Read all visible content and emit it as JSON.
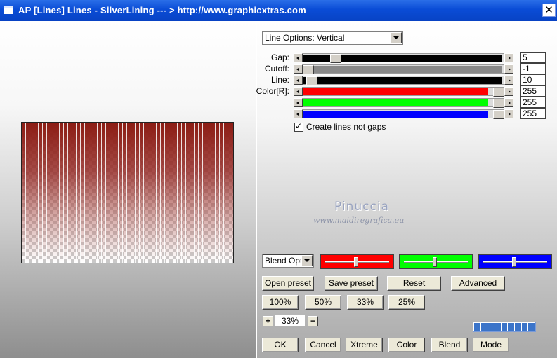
{
  "window": {
    "title": "AP [Lines]  Lines - SilverLining     --- > http://www.graphicxtras.com",
    "close_glyph": "✕"
  },
  "line_options": {
    "selected": "Line Options: Vertical"
  },
  "sliders": [
    {
      "label": "Gap:",
      "value": "5",
      "fill_color": "#000000",
      "level": 0.05
    },
    {
      "label": "Cutoff:",
      "value": "-1",
      "fill_color": "#888888",
      "level": 0.0
    },
    {
      "label": "Line:",
      "value": "10",
      "fill_color": "#000000",
      "level": 0.02
    },
    {
      "label": "Color[R]:",
      "value": "255",
      "fill_color": "#ff0000",
      "level": 1.0
    },
    {
      "label": "",
      "value": "255",
      "fill_color": "#00ff00",
      "level": 1.0
    },
    {
      "label": "",
      "value": "255",
      "fill_color": "#0000ff",
      "level": 1.0
    }
  ],
  "checkbox": {
    "label": "Create lines not gaps",
    "checked": true
  },
  "watermark": {
    "name": "Pinuccia",
    "url": "www.maidiregrafica.eu"
  },
  "blend": {
    "selected": "Blend Options",
    "color_boxes": [
      {
        "color": "#ff0000",
        "level": 0.5
      },
      {
        "color": "#00ff00",
        "level": 0.5
      },
      {
        "color": "#0000ff",
        "level": 0.5
      }
    ]
  },
  "preset_buttons": {
    "open": "Open preset",
    "save": "Save preset",
    "reset": "Reset",
    "advanced": "Advanced"
  },
  "zoom_buttons": [
    "100%",
    "50%",
    "33%",
    "25%"
  ],
  "zoom": {
    "plus": "+",
    "minus": "−",
    "value": "33%"
  },
  "bottom_buttons": [
    "OK",
    "Cancel",
    "Xtreme",
    "Color",
    "Blend",
    "Mode"
  ],
  "progress": {
    "segments": 9
  }
}
